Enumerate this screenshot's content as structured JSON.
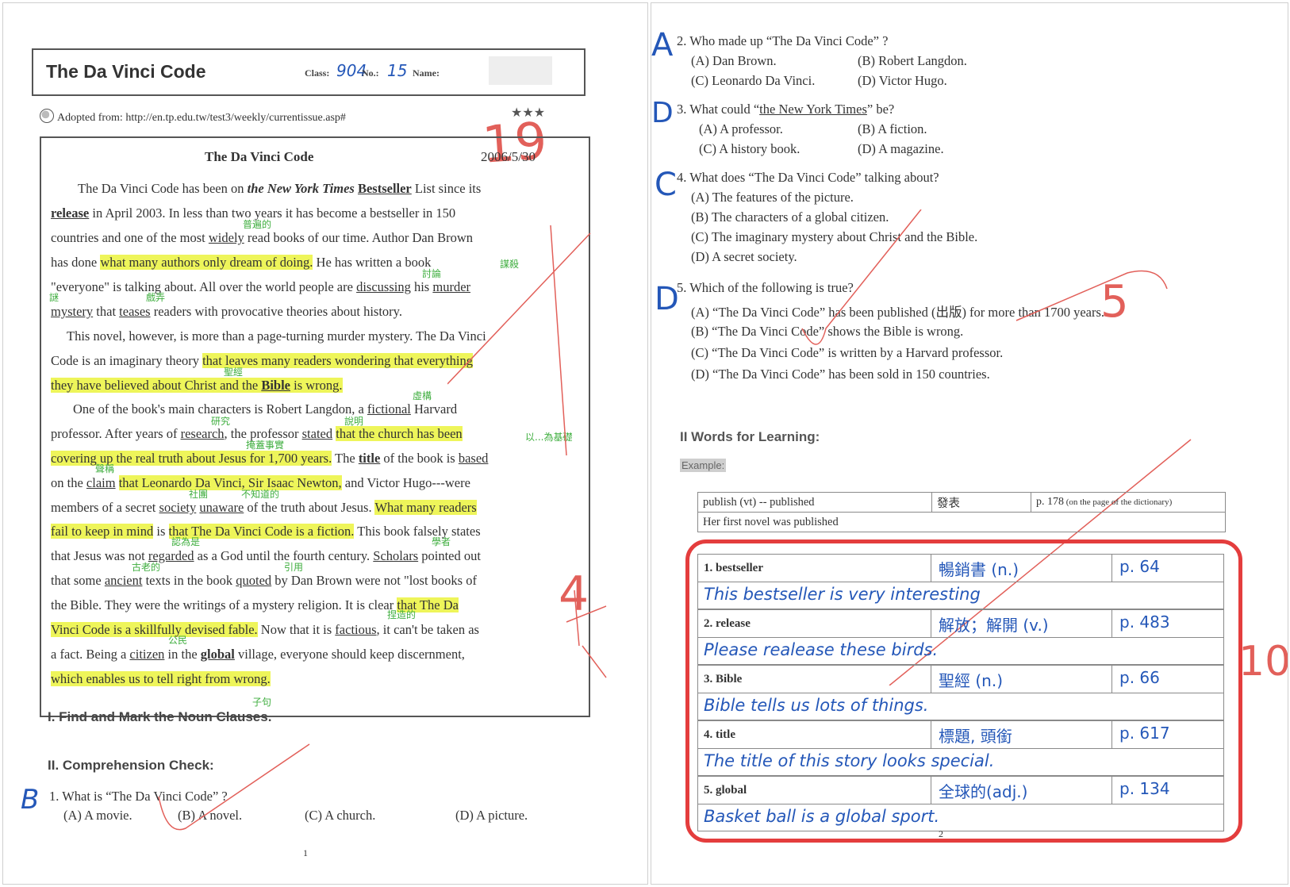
{
  "left_page": {
    "header": {
      "title": "The Da Vinci Code",
      "class_label": "Class:",
      "class_value": "904",
      "no_label": "No.:",
      "no_value": "15",
      "name_label": "Name:",
      "source": "Adopted from: http://en.tp.edu.tw/test3/weekly/currentissue.asp#",
      "stars": "★★★",
      "score": "19"
    },
    "article": {
      "title": "The Da Vinci Code",
      "date": "2006/5/30",
      "p1": {
        "a": "The Da Vinci Code has been on ",
        "b": "the New York Times",
        "c": " ",
        "d": "Bestseller",
        "e": " List since its",
        "f": "release",
        "g": " in April 2003. In less than two years it has become a bestseller in 150",
        "h": "countries and one of the most ",
        "i": "widely",
        "j": " read books of our time. Author Dan Brown",
        "k": "has done ",
        "l": "what many authors only dream of doing.",
        "m": " He has written a book",
        "n": "\"everyone\" is talking about. All over the world people are ",
        "o": "discussing",
        "p": " his ",
        "q": "murder",
        "r": "mystery",
        "s": " that ",
        "t": "teases",
        "u": " readers with provocative theories about history."
      },
      "p2": {
        "a": "This novel, however, is more than a page-turning murder mystery. The Da Vinci",
        "b": "Code is an imaginary theory ",
        "c": "that leaves many readers wondering that everything",
        "d": "they have believed about Christ and the ",
        "e": "Bible",
        "f": " is wrong."
      },
      "p3": {
        "a": "One of the book's main characters is Robert Langdon, a ",
        "b": "fictional",
        "c": " Harvard",
        "d": "professor. After years of ",
        "e": "research",
        "f": ", the professor ",
        "g": "stated",
        "h": " ",
        "i": "that the church has been",
        "j": "covering up the real truth about Jesus for 1,700 years.",
        "k": " The ",
        "l": "title",
        "m": " of the book is ",
        "n": "based",
        "o": "on the ",
        "p": "claim",
        "q": " ",
        "r": "that Leonardo Da Vinci, Sir Isaac Newton,",
        "s": " and Victor Hugo---were",
        "t": "members of a secret ",
        "u": "society",
        "v": " ",
        "w": "unaware",
        "x": " of the truth about Jesus. ",
        "y": "What many readers",
        "z": "fail to keep in mind",
        "aa": " is ",
        "ab": "that The Da Vinci Code is a fiction.",
        "ac": " This book falsely states",
        "ad": "that Jesus was not ",
        "ae": "regarded",
        "af": " as a God until the fourth century. ",
        "ag": "Scholars",
        "ah": " pointed out",
        "ai": "that some ",
        "aj": "ancient",
        "ak": " texts in the book ",
        "al": "quoted",
        "am": " by Dan Brown were not \"lost books of",
        "an": "the Bible. They were the writings of a mystery religion. It is clear ",
        "ao": "that The Da",
        "ap": "Vinci Code is a skillfully devised fable.",
        "aq": " Now that it is ",
        "ar": "factious",
        "as": ", it can't be taken as",
        "at": "a fact. Being a ",
        "au": "citizen",
        "av": " in the ",
        "aw": "global",
        "ax": " village, everyone should keep discernment,",
        "ay": "which enables us to tell right from wrong."
      }
    },
    "notes": {
      "n1": "普遍的",
      "n2": "討論",
      "n3": "謀殺",
      "n4": "謎",
      "n5": "戲弄",
      "n6": "聖經",
      "n7": "虛構",
      "n8": "研究",
      "n9": "說明",
      "n10": "以...為基礎",
      "n11": "掩蓋事實",
      "n12": "聲稱",
      "n13": "社團",
      "n14": "不知道的",
      "n15": "認為是",
      "n16": "學者",
      "n17": "古老的",
      "n18": "引用",
      "n19": "捏造的",
      "n20": "公民",
      "n21": "子句"
    },
    "section1": "I. Find and Mark the Noun Clauses.",
    "section2": "II. Comprehension Check:",
    "q1": {
      "answer": "B",
      "stem": "1. What is “The Da Vinci Code” ?",
      "a": "(A) A movie.",
      "b": "(B) A novel.",
      "c": "(C) A church.",
      "d": "(D) A picture."
    },
    "page_number": "1",
    "margin_mark": "4"
  },
  "right_page": {
    "q2": {
      "answer": "A",
      "stem": "2. Who made up “The Da Vinci Code” ?",
      "a": "(A) Dan Brown.",
      "b": "(B) Robert Langdon.",
      "c": "(C) Leonardo Da Vinci.",
      "d": "(D) Victor Hugo."
    },
    "q3": {
      "answer": "D",
      "num": "3. What could “",
      "u": "the New York Times",
      "end": "” be?",
      "a": "(A) A professor.",
      "b": "(B) A fiction.",
      "c": "(C) A history book.",
      "d": "(D) A magazine."
    },
    "q4": {
      "answer": "C",
      "stem": "4. What does “The Da Vinci Code” talking about?",
      "a": "(A) The features of the picture.",
      "b": "(B) The characters of a global citizen.",
      "c": "(C) The imaginary mystery about Christ and the Bible.",
      "d": "(D) A secret society."
    },
    "q5": {
      "answer": "D",
      "stem": "5. Which of the following is true?",
      "a": "(A) “The Da Vinci Code” has been published (出版) for more than 1700 years.",
      "b": "(B) “The Da Vinci Code” shows the Bible is wrong.",
      "c": "(C) “The Da Vinci Code” is written by a Harvard professor.",
      "d": "(D) “The Da Vinci Code” has been sold in 150 countries."
    },
    "score_5": "5",
    "score_10": "10",
    "words_heading": "II Words for Learning:",
    "example_label": "Example:",
    "example": {
      "word": "publish (vt) -- published",
      "meaning": "發表",
      "page": "p. 178",
      "page_note": " (on the page of the dictionary)",
      "sentence": "Her first novel was published"
    },
    "words": [
      {
        "word": "1. bestseller",
        "meaning": "暢銷書 (n.)",
        "page": "p. 64",
        "sentence": "This bestseller is very interesting"
      },
      {
        "word": "2. release",
        "meaning": "解放；解開 (v.)",
        "page": "p. 483",
        "sentence": "Please realease these birds."
      },
      {
        "word": "3. Bible",
        "meaning": "聖經 (n.)",
        "page": "p. 66",
        "sentence": "Bible tells us lots of things."
      },
      {
        "word": "4. title",
        "meaning": "標題, 頭銜",
        "page": "p. 617",
        "sentence": "The title of this story looks special."
      },
      {
        "word": "5. global",
        "meaning": "全球的(adj.)",
        "page": "p. 134",
        "sentence": "Basket ball is a global sport."
      }
    ],
    "page_number": "2"
  }
}
